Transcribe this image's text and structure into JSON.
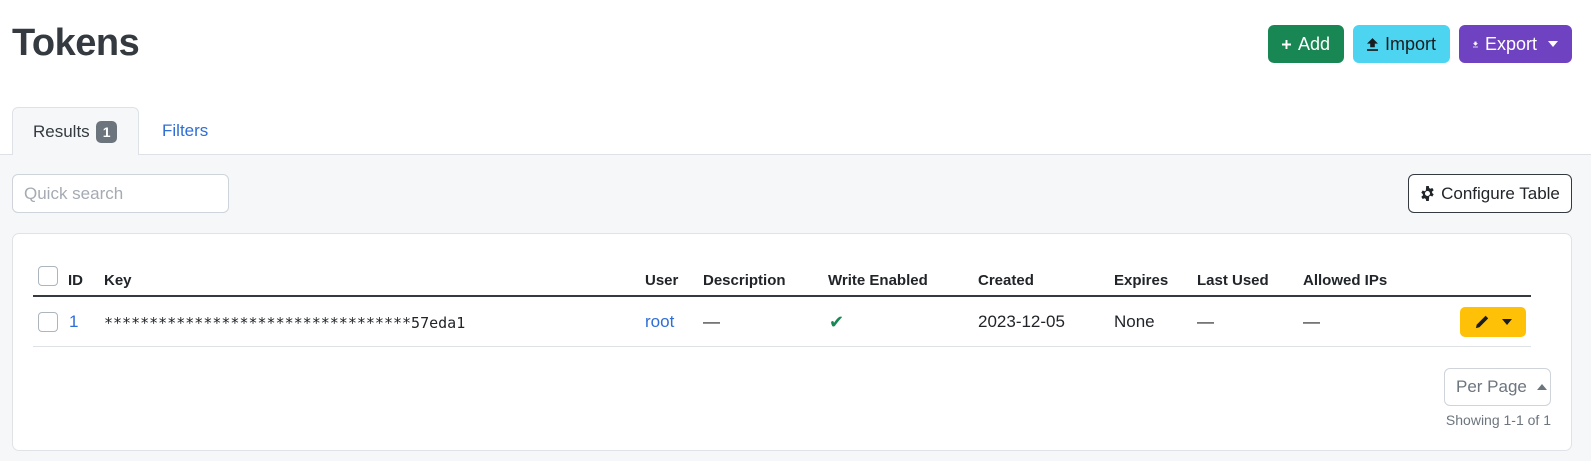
{
  "page": {
    "title": "Tokens"
  },
  "actions": {
    "add": "Add",
    "import": "Import",
    "export": "Export"
  },
  "tabs": {
    "results": "Results",
    "results_count": "1",
    "filters": "Filters"
  },
  "search": {
    "placeholder": "Quick search",
    "value": ""
  },
  "configure_table": "Configure Table",
  "table": {
    "columns": [
      "ID",
      "Key",
      "User",
      "Description",
      "Write Enabled",
      "Created",
      "Expires",
      "Last Used",
      "Allowed IPs"
    ],
    "rows": [
      {
        "id": "1",
        "key": "**********************************57eda1",
        "user": "root",
        "description": "—",
        "write_enabled": "✔",
        "created": "2023-12-05",
        "expires": "None",
        "last_used": "—",
        "allowed_ips": "—"
      }
    ]
  },
  "pagination": {
    "per_page": "Per Page",
    "showing": "Showing 1-1 of 1"
  },
  "colors": {
    "add": "#198754",
    "import": "#4dd4f0",
    "export": "#6f42c1",
    "row_action": "#ffc107",
    "link": "#2f6ed6",
    "success": "#198754"
  },
  "icons": {
    "add": "plus-icon",
    "import": "upload-icon",
    "export": "download-icon",
    "configure": "gear-icon",
    "edit": "pencil-icon",
    "write_enabled": "checkmark-icon"
  }
}
